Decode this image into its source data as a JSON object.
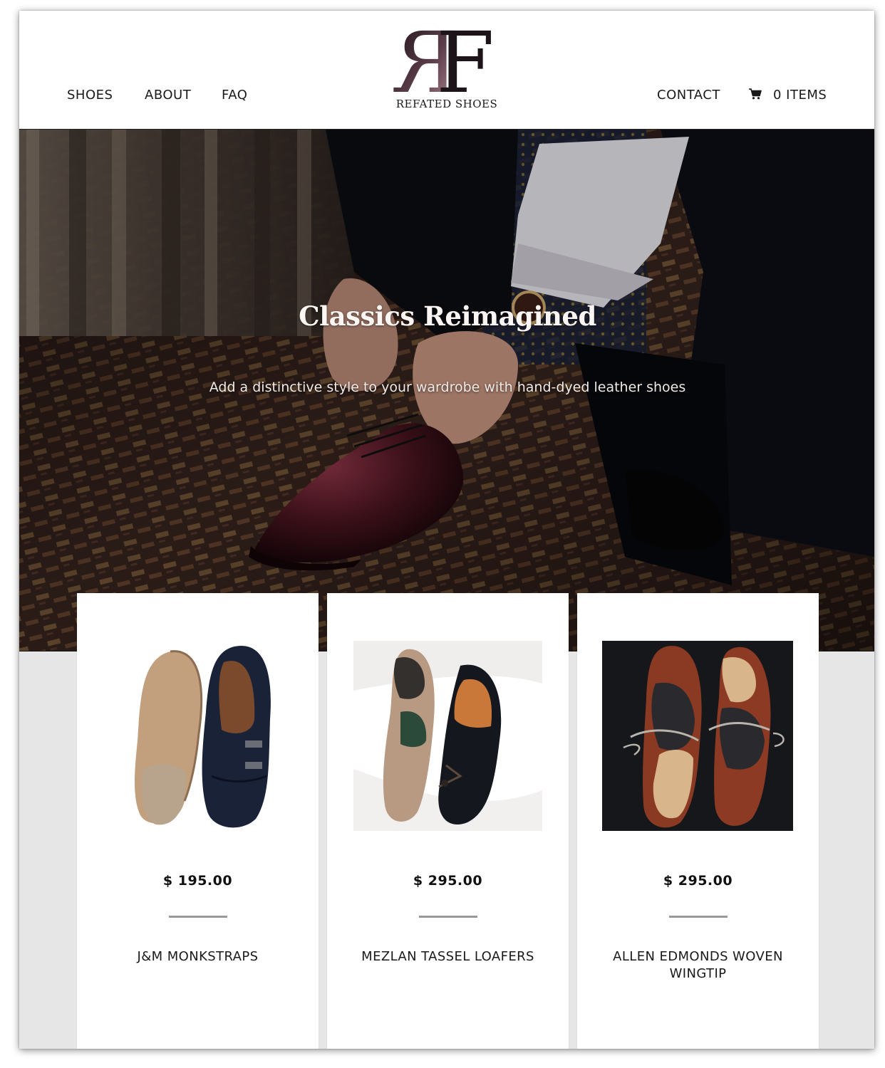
{
  "header": {
    "nav_left": [
      "SHOES",
      "ABOUT",
      "FAQ"
    ],
    "logo_monogram": "RF",
    "logo_text": "REFATED SHOES",
    "contact_label": "CONTACT",
    "cart_label": "0 ITEMS",
    "cart_icon": "shopping-cart-icon"
  },
  "hero": {
    "title": "Classics Reimagined",
    "subtitle": "Add a distinctive style to your wardrobe with hand-dyed leather shoes"
  },
  "products": [
    {
      "price": "$ 195.00",
      "name": "J&M MONKSTRAPS"
    },
    {
      "price": "$ 295.00",
      "name": "MEZLAN TASSEL LOAFERS"
    },
    {
      "price": "$ 295.00",
      "name": "ALLEN EDMONDS WOVEN WINGTIP"
    }
  ],
  "colors": {
    "logo_gradient_start": "#a07d86",
    "logo_gradient_end": "#1e141a",
    "divider": "#999999",
    "page_background": "#e6e6e6"
  }
}
